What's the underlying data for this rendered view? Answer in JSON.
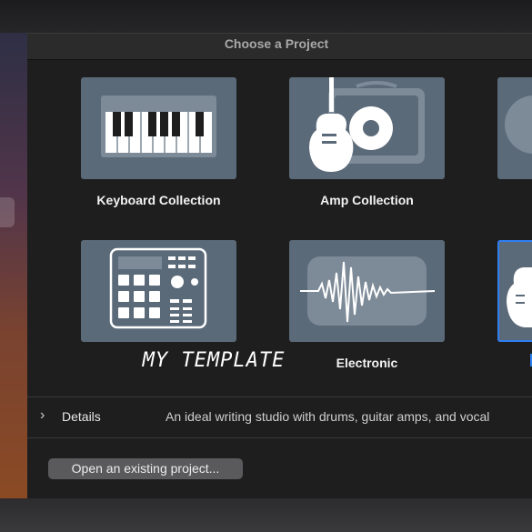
{
  "dialog": {
    "title": "Choose a Project"
  },
  "templates": [
    {
      "label": "Keyboard Collection",
      "icon": "piano-keyboard-icon"
    },
    {
      "label": "Amp Collection",
      "icon": "guitar-amp-icon"
    },
    {
      "label": "MY TEMPLATE",
      "icon": "drum-machine-icon"
    },
    {
      "label": "Electronic",
      "icon": "waveform-icon"
    }
  ],
  "details": {
    "chevron": "›",
    "label": "Details",
    "description": "An ideal writing studio with drums, guitar amps, and vocal"
  },
  "footer": {
    "open_button_label": "Open an existing project..."
  },
  "colors": {
    "tile": "#5b6a79",
    "selection": "#2f7ef3",
    "dialog_bg": "#1e1e1e"
  }
}
